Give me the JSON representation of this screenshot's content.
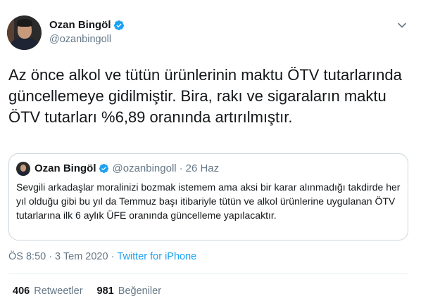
{
  "author": {
    "display_name": "Ozan Bingöl",
    "handle": "@ozanbingoll"
  },
  "tweet": {
    "text": "Az önce alkol ve tütün ürünlerinin maktu ÖTV tutarlarında güncellemeye gidilmiştir. Bira, rakı ve sigaraların maktu ÖTV tutarları %6,89 oranında artırılmıştır.",
    "time": "ÖS 8:50",
    "date": "3 Tem 2020",
    "dot": "·",
    "source": "Twitter for iPhone"
  },
  "quoted": {
    "display_name": "Ozan Bingöl",
    "handle": "@ozanbingoll",
    "separator": "·",
    "date": "26 Haz",
    "text": "Sevgili arkadaşlar moralinizi bozmak istemem ama aksi bir karar alınmadığı takdirde her yıl olduğu gibi bu yıl da Temmuz başı itibariyle tütün ve alkol ürünlerine uygulanan ÖTV tutarlarına ilk 6 aylık ÜFE oranında güncelleme yapılacaktır."
  },
  "stats": {
    "retweets_count": "406",
    "retweets_label": "Retweetler",
    "likes_count": "981",
    "likes_label": "Beğeniler"
  },
  "colors": {
    "accent": "#1da1f2",
    "muted": "#657786",
    "border": "#ccd6dd"
  },
  "icons": {
    "verified": "verified-badge-icon",
    "more": "chevron-down-icon"
  }
}
